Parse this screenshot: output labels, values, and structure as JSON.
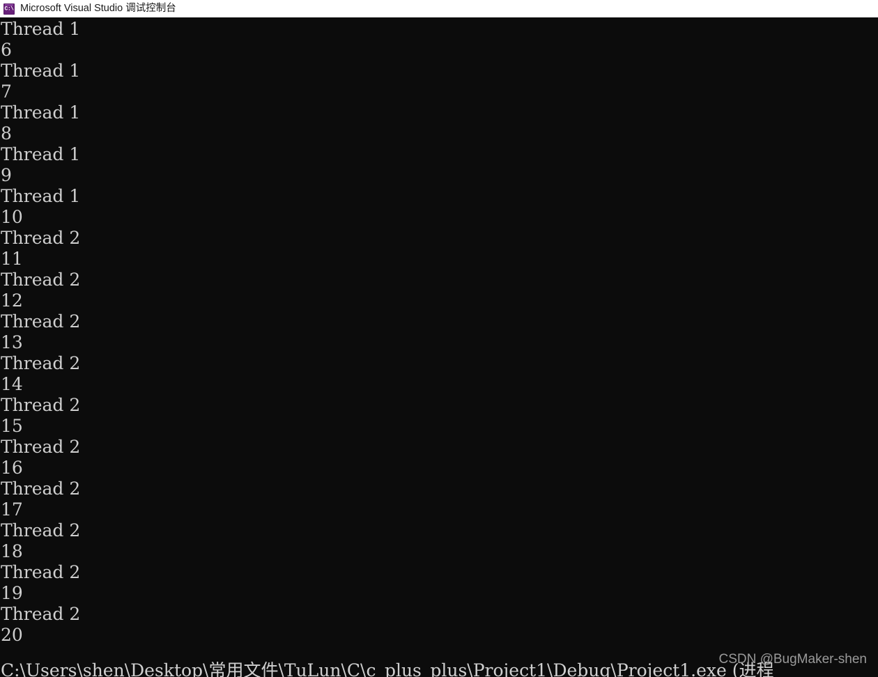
{
  "window": {
    "title": "Microsoft Visual Studio 调试控制台",
    "icon_name": "console-app-icon",
    "icon_glyph": "C:\\",
    "titlebar_background": "#ffffff",
    "titlebar_text_color": "#1a1a1a",
    "icon_color": "#68217a"
  },
  "console": {
    "background": "#0c0c0c",
    "text_color": "#cfcfcf",
    "lines": [
      "Thread 1",
      "6",
      "Thread 1",
      "7",
      "Thread 1",
      "8",
      "Thread 1",
      "9",
      "Thread 1",
      "10",
      "Thread 2",
      "11",
      "Thread 2",
      "12",
      "Thread 2",
      "13",
      "Thread 2",
      "14",
      "Thread 2",
      "15",
      "Thread 2",
      "16",
      "Thread 2",
      "17",
      "Thread 2",
      "18",
      "Thread 2",
      "19",
      "Thread 2",
      "20"
    ],
    "exit_path_line": "C:\\Users\\shen\\Desktop\\常用文件\\TuLun\\C\\c_plus_plus\\Project1\\Debug\\Project1.exe (进程"
  },
  "watermark": {
    "text": "CSDN @BugMaker-shen",
    "color": "#9a9a9a"
  }
}
